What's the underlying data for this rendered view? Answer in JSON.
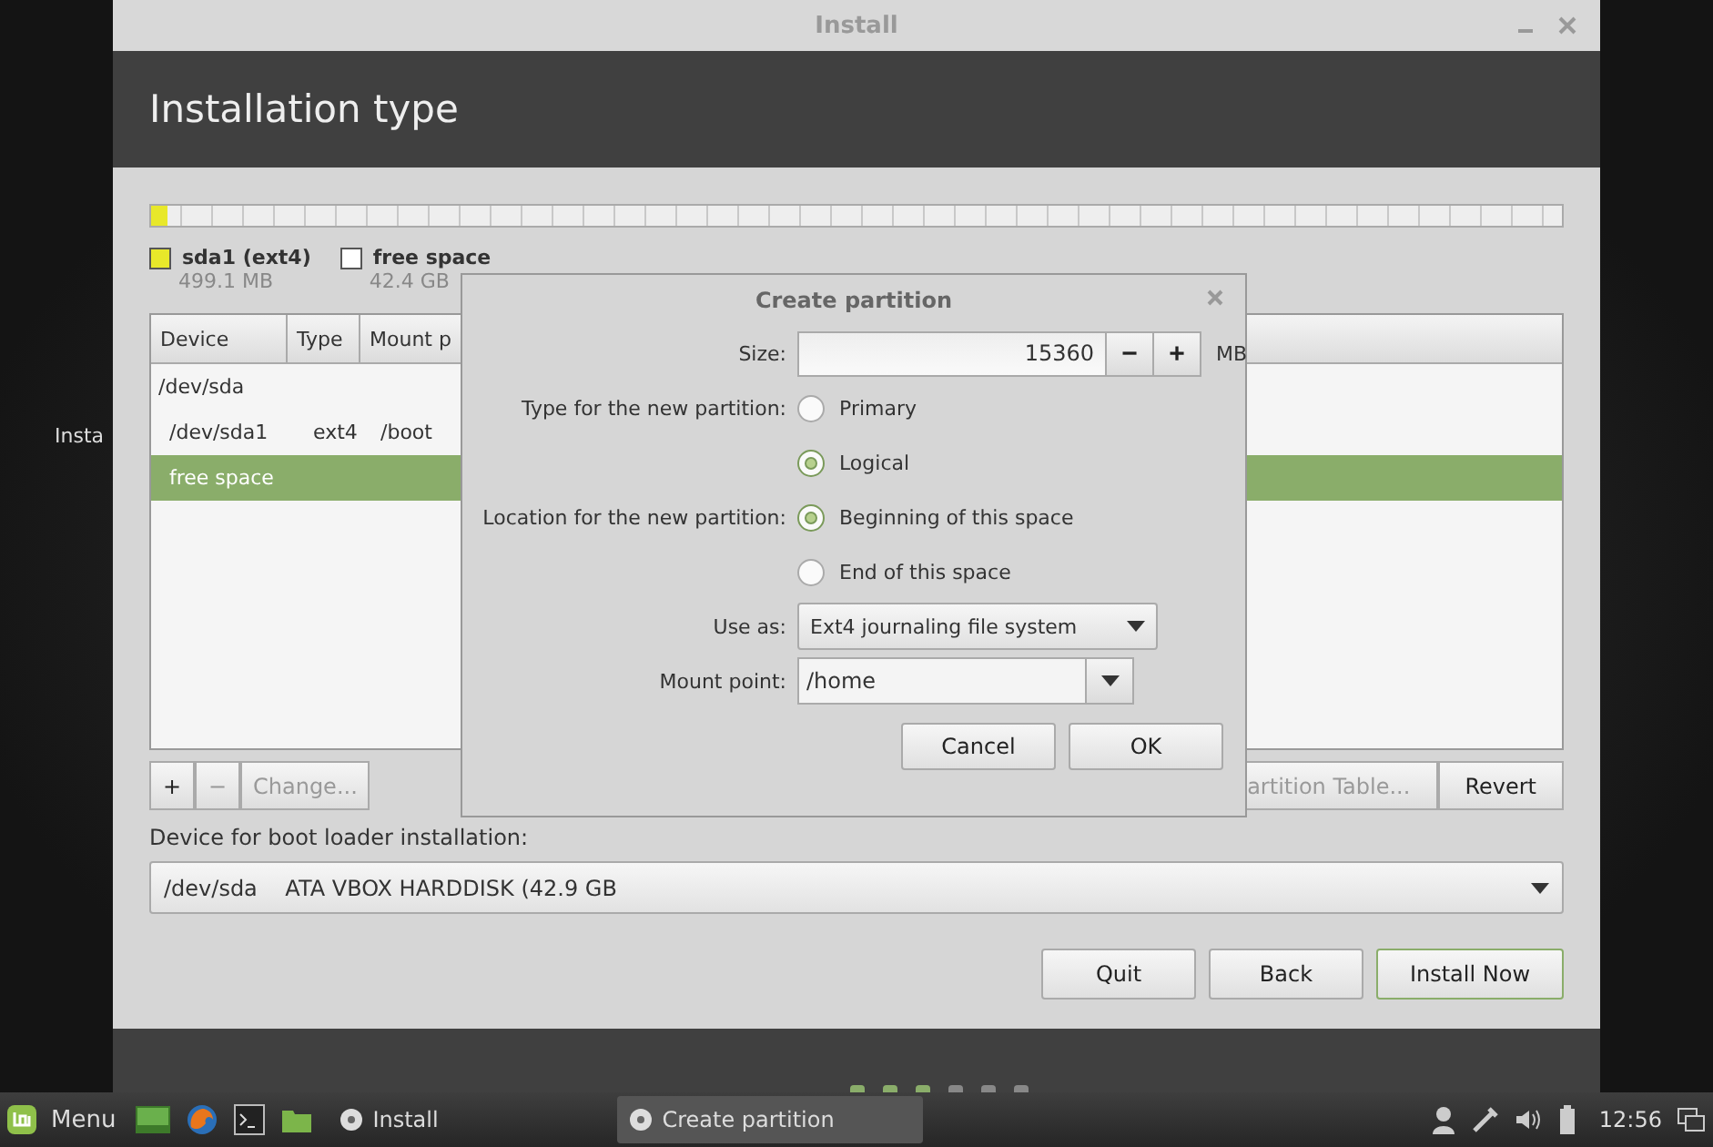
{
  "desktop": {
    "icon_labels": [
      "Insta"
    ]
  },
  "window": {
    "title": "Install",
    "header": "Installation type",
    "partition_bar": {
      "level": 0.012
    },
    "legend": [
      {
        "name": "sda1 (ext4)",
        "size": "499.1 MB",
        "color": "#e8e82a"
      },
      {
        "name": "free space",
        "size": "42.4 GB",
        "color": "#ffffff"
      }
    ],
    "table": {
      "columns": [
        "Device",
        "Type",
        "Mount p"
      ],
      "rows": [
        {
          "cells": [
            "/dev/sda",
            "",
            ""
          ],
          "selected": false,
          "child": false
        },
        {
          "cells": [
            "/dev/sda1",
            "ext4",
            "/boot"
          ],
          "selected": false,
          "child": true
        },
        {
          "cells": [
            "free space",
            "",
            ""
          ],
          "selected": true,
          "child": true
        }
      ]
    },
    "table_buttons": [
      {
        "label": "+",
        "disabled": false
      },
      {
        "label": "−",
        "disabled": true
      },
      {
        "label": "Change...",
        "disabled": true
      }
    ],
    "right_buttons": [
      {
        "label": "artition Table...",
        "disabled": true
      },
      {
        "label": "Revert",
        "disabled": false
      }
    ],
    "bootloader_label": "Device for boot loader installation:",
    "bootloader_value": "/dev/sda    ATA VBOX HARDDISK (42.9 GB",
    "buttons": [
      {
        "label": "Quit",
        "default": false
      },
      {
        "label": "Back",
        "default": false
      },
      {
        "label": "Install Now",
        "default": true
      }
    ],
    "steps": [
      {
        "done": true
      },
      {
        "done": true
      },
      {
        "done": true
      },
      {
        "done": false
      },
      {
        "done": false
      },
      {
        "done": false
      }
    ]
  },
  "dialog": {
    "title": "Create partition",
    "size_label": "Size:",
    "size_value": "15360",
    "minus": "−",
    "plus": "+",
    "unit": "MB",
    "type_label": "Type for the new partition:",
    "type_options": [
      {
        "label": "Primary",
        "selected": false
      },
      {
        "label": "Logical",
        "selected": true
      }
    ],
    "location_label": "Location for the new partition:",
    "location_options": [
      {
        "label": "Beginning of this space",
        "selected": true
      },
      {
        "label": "End of this space",
        "selected": false
      }
    ],
    "use_as_label": "Use as:",
    "use_as_value": "Ext4 journaling file system",
    "mount_label": "Mount point:",
    "mount_value": "/home",
    "buttons": [
      "Cancel",
      "OK"
    ]
  },
  "taskbar": {
    "menu": "Menu",
    "windows": [
      {
        "label": "Install",
        "selected": false
      },
      {
        "label": "Create partition",
        "selected": true
      }
    ],
    "clock": "12:56"
  }
}
